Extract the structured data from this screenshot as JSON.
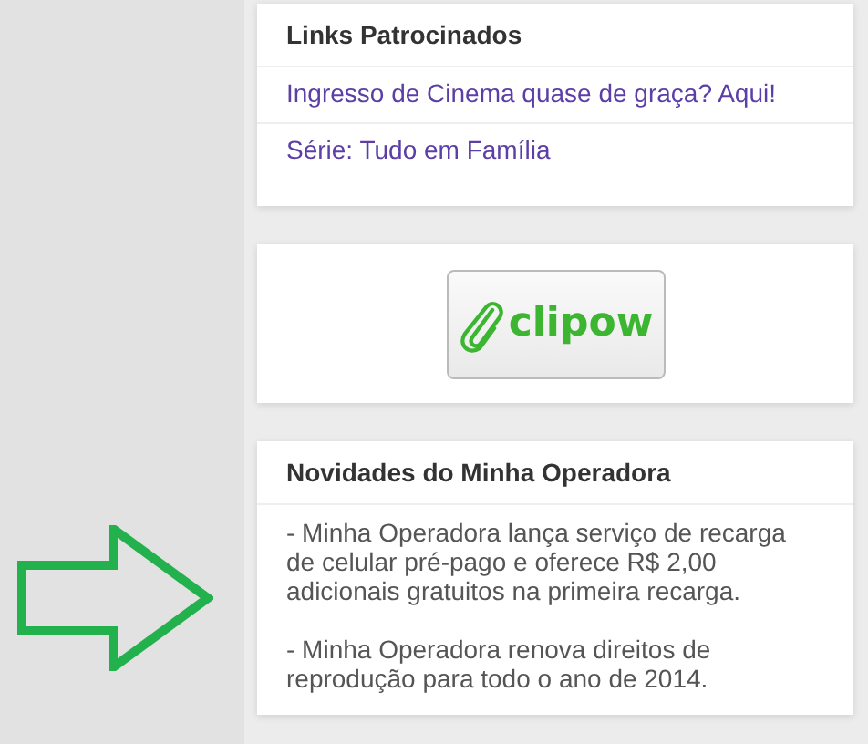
{
  "sponsored": {
    "title": "Links Patrocinados",
    "links": [
      {
        "label": "Ingresso de Cinema quase de graça? Aqui!"
      },
      {
        "label": "Série: Tudo em Família"
      }
    ]
  },
  "promo": {
    "logo_text": "clipow"
  },
  "news": {
    "title": "Novidades do Minha Operadora",
    "items": [
      "- Minha Operadora lança serviço de recarga de celular pré-pago e oferece R$ 2,00 adicionais gratuitos na primeira recarga.",
      "- Minha Operadora renova direitos de reprodução para todo o ano de 2014."
    ]
  }
}
